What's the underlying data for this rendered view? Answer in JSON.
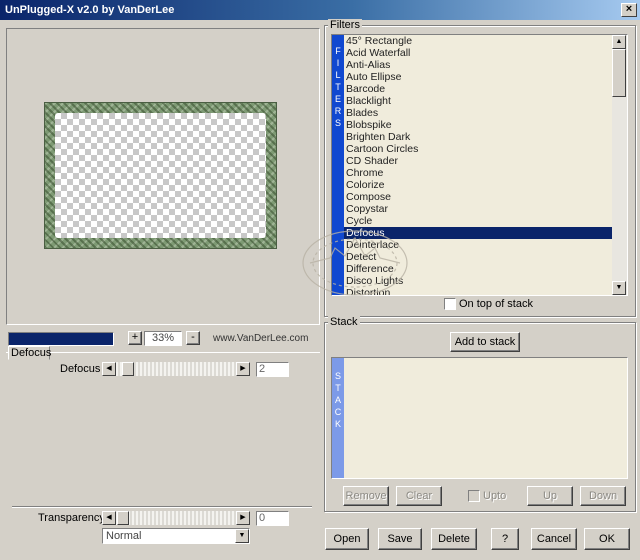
{
  "window": {
    "title": "UnPlugged-X v2.0 by VanDerLee",
    "close_glyph": "×"
  },
  "preview": {
    "zoom_minus": "-",
    "zoom_plus": "+",
    "zoom_level": "33%",
    "website": "www.VanDerLee.com"
  },
  "filters": {
    "group_label": "Filters",
    "side_letters": [
      "F",
      "I",
      "L",
      "T",
      "E",
      "R",
      "S"
    ],
    "items": [
      "45° Rectangle",
      "Acid Waterfall",
      "Anti-Alias",
      "Auto Ellipse",
      "Barcode",
      "Blacklight",
      "Blades",
      "Blobspike",
      "Brighten Dark",
      "Cartoon Circles",
      "CD Shader",
      "Chrome",
      "Colorize",
      "Compose",
      "Copystar",
      "Cycle",
      "Defocus",
      "Deinterlace",
      "Detect",
      "Difference",
      "Disco Lights",
      "Distortion"
    ],
    "selected": "Defocus",
    "on_top_label": "On top of stack",
    "on_top_checked": false
  },
  "settings": {
    "tab_label": "Defocus",
    "param_label": "Defocus",
    "param_value": "2",
    "param_fraction": 0.0,
    "transparency_label": "Transparency",
    "transparency_value": "0",
    "transparency_fraction": 0.0,
    "blend_mode": "Normal"
  },
  "stack": {
    "group_label": "Stack",
    "add_button": "Add to stack",
    "side_letters": [
      "S",
      "T",
      "A",
      "C",
      "K"
    ],
    "remove": "Remove",
    "clear": "Clear",
    "upto_label": "Upto",
    "up": "Up",
    "down": "Down"
  },
  "footer": {
    "open": "Open",
    "save": "Save",
    "delete": "Delete",
    "help": "?",
    "cancel": "Cancel",
    "ok": "OK"
  },
  "colors": {
    "accent": "#0a246a",
    "sidebar_blue": "#1048d0",
    "stack_blue": "#7c9ae8",
    "list_bg": "#f0ecdc"
  }
}
